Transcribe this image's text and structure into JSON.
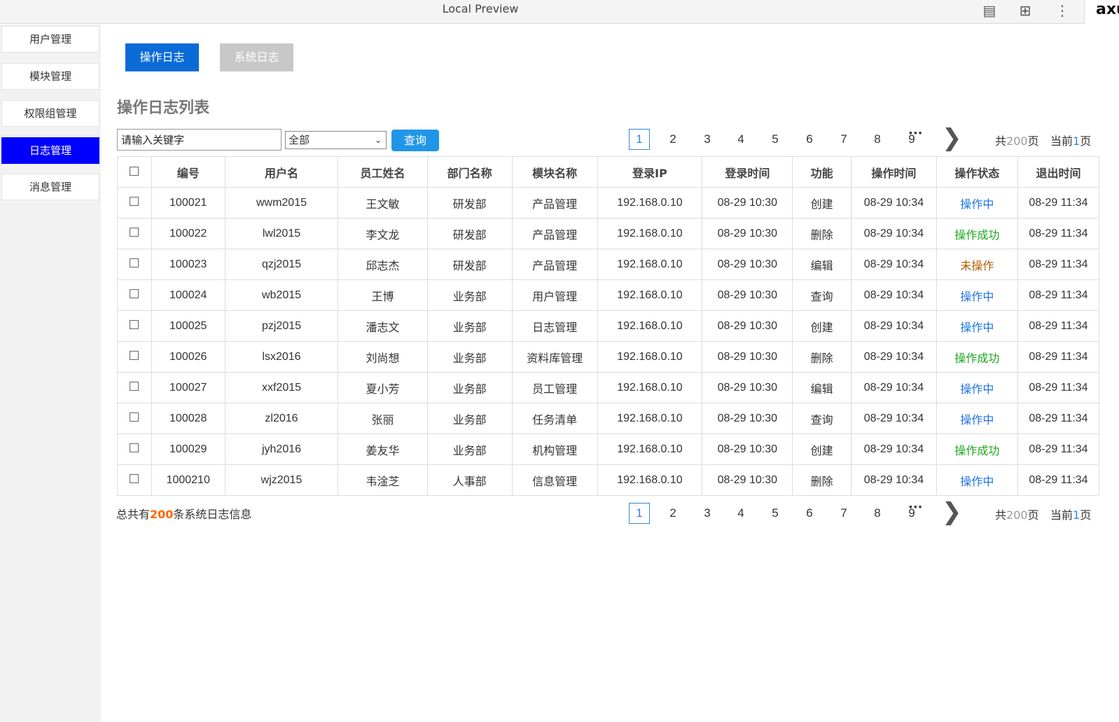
{
  "window": {
    "title": "Local Preview",
    "brand": "axu"
  },
  "sidebar": {
    "items": [
      {
        "label": "用户管理",
        "active": false
      },
      {
        "label": "模块管理",
        "active": false
      },
      {
        "label": "权限组管理",
        "active": false
      },
      {
        "label": "日志管理",
        "active": true
      },
      {
        "label": "消息管理",
        "active": false
      }
    ]
  },
  "tabs": [
    {
      "label": "操作日志",
      "active": true
    },
    {
      "label": "系统日志",
      "active": false
    }
  ],
  "section_title": "操作日志列表",
  "search": {
    "placeholder": "请输入关键字"
  },
  "filter": {
    "selected": "全部"
  },
  "query_label": "查询",
  "pagination": {
    "pages": [
      "1",
      "2",
      "3",
      "4",
      "5",
      "6",
      "7",
      "8",
      "9"
    ],
    "current": "1",
    "ellipsis": "···",
    "total_prefix": "共",
    "total_pages": "200",
    "total_suffix": "页",
    "current_prefix": "当前",
    "current_page": "1",
    "current_suffix": "页"
  },
  "table": {
    "headers": [
      "编号",
      "用户名",
      "员工姓名",
      "部门名称",
      "模块名称",
      "登录IP",
      "登录时间",
      "功能",
      "操作时间",
      "操作状态",
      "退出时间"
    ],
    "rows": [
      {
        "id": "100021",
        "username": "wwm2015",
        "name": "王文敏",
        "dept": "研发部",
        "module": "产品管理",
        "ip": "192.168.0.10",
        "login": "08-29 10:30",
        "func": "创建",
        "optime": "08-29 10:34",
        "status": "操作中",
        "status_color": "#1a73e8",
        "logout": "08-29 11:34"
      },
      {
        "id": "100022",
        "username": "lwl2015",
        "name": "李文龙",
        "dept": "研发部",
        "module": "产品管理",
        "ip": "192.168.0.10",
        "login": "08-29 10:30",
        "func": "删除",
        "optime": "08-29 10:34",
        "status": "操作成功",
        "status_color": "#1aa81a",
        "logout": "08-29 11:34"
      },
      {
        "id": "100023",
        "username": "qzj2015",
        "name": "邱志杰",
        "dept": "研发部",
        "module": "产品管理",
        "ip": "192.168.0.10",
        "login": "08-29 10:30",
        "func": "编辑",
        "optime": "08-29 10:34",
        "status": "未操作",
        "status_color": "#b85a00",
        "logout": "08-29 11:34"
      },
      {
        "id": "100024",
        "username": "wb2015",
        "name": "王博",
        "dept": "业务部",
        "module": "用户管理",
        "ip": "192.168.0.10",
        "login": "08-29 10:30",
        "func": "查询",
        "optime": "08-29 10:34",
        "status": "操作中",
        "status_color": "#1a73e8",
        "logout": "08-29 11:34"
      },
      {
        "id": "100025",
        "username": "pzj2015",
        "name": "潘志文",
        "dept": "业务部",
        "module": "日志管理",
        "ip": "192.168.0.10",
        "login": "08-29 10:30",
        "func": "创建",
        "optime": "08-29 10:34",
        "status": "操作中",
        "status_color": "#1a73e8",
        "logout": "08-29 11:34"
      },
      {
        "id": "100026",
        "username": "lsx2016",
        "name": "刘尚想",
        "dept": "业务部",
        "module": "资料库管理",
        "ip": "192.168.0.10",
        "login": "08-29 10:30",
        "func": "删除",
        "optime": "08-29 10:34",
        "status": "操作成功",
        "status_color": "#1aa81a",
        "logout": "08-29 11:34"
      },
      {
        "id": "100027",
        "username": "xxf2015",
        "name": "夏小芳",
        "dept": "业务部",
        "module": "员工管理",
        "ip": "192.168.0.10",
        "login": "08-29 10:30",
        "func": "编辑",
        "optime": "08-29 10:34",
        "status": "操作中",
        "status_color": "#1a73e8",
        "logout": "08-29 11:34"
      },
      {
        "id": "100028",
        "username": "zl2016",
        "name": "张丽",
        "dept": "业务部",
        "module": "任务清单",
        "ip": "192.168.0.10",
        "login": "08-29 10:30",
        "func": "查询",
        "optime": "08-29 10:34",
        "status": "操作中",
        "status_color": "#1a73e8",
        "logout": "08-29 11:34"
      },
      {
        "id": "100029",
        "username": "jyh2016",
        "name": "姜友华",
        "dept": "业务部",
        "module": "机构管理",
        "ip": "192.168.0.10",
        "login": "08-29 10:30",
        "func": "创建",
        "optime": "08-29 10:34",
        "status": "操作成功",
        "status_color": "#1aa81a",
        "logout": "08-29 11:34"
      },
      {
        "id": "1000210",
        "username": "wjz2015",
        "name": "韦淦芝",
        "dept": "人事部",
        "module": "信息管理",
        "ip": "192.168.0.10",
        "login": "08-29 10:30",
        "func": "删除",
        "optime": "08-29 10:34",
        "status": "操作中",
        "status_color": "#1a73e8",
        "logout": "08-29 11:34"
      }
    ]
  },
  "summary": {
    "prefix": "总共有",
    "count": "200",
    "suffix": "条系统日志信息"
  }
}
